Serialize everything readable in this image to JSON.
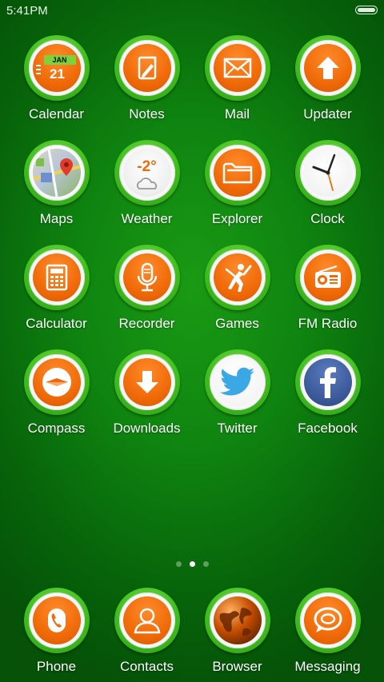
{
  "status": {
    "time": "5:41PM"
  },
  "apps": [
    [
      {
        "label": "Calendar",
        "icon": "calendar-icon",
        "month": "JAN",
        "day": "21"
      },
      {
        "label": "Notes",
        "icon": "notes-icon"
      },
      {
        "label": "Mail",
        "icon": "mail-icon"
      },
      {
        "label": "Updater",
        "icon": "arrow-up-icon"
      }
    ],
    [
      {
        "label": "Maps",
        "icon": "map-pin-icon"
      },
      {
        "label": "Weather",
        "icon": "cloud-icon",
        "temp": "-2°"
      },
      {
        "label": "Explorer",
        "icon": "folder-icon"
      },
      {
        "label": "Clock",
        "icon": "clock-icon"
      }
    ],
    [
      {
        "label": "Calculator",
        "icon": "calculator-icon"
      },
      {
        "label": "Recorder",
        "icon": "microphone-icon"
      },
      {
        "label": "Games",
        "icon": "cricket-player-icon"
      },
      {
        "label": "FM Radio",
        "icon": "radio-icon"
      }
    ],
    [
      {
        "label": "Compass",
        "icon": "compass-icon"
      },
      {
        "label": "Downloads",
        "icon": "arrow-down-icon"
      },
      {
        "label": "Twitter",
        "icon": "twitter-bird-icon"
      },
      {
        "label": "Facebook",
        "icon": "facebook-icon"
      }
    ]
  ],
  "pager": {
    "count": 3,
    "active": 1
  },
  "dock": [
    {
      "label": "Phone",
      "icon": "phone-icon"
    },
    {
      "label": "Contacts",
      "icon": "person-icon"
    },
    {
      "label": "Browser",
      "icon": "globe-icon"
    },
    {
      "label": "Messaging",
      "icon": "speech-bubble-icon"
    }
  ],
  "colors": {
    "accent_orange": "#f06a08",
    "ring_green": "#3fbf1e",
    "bg_green": "#0f8410"
  }
}
